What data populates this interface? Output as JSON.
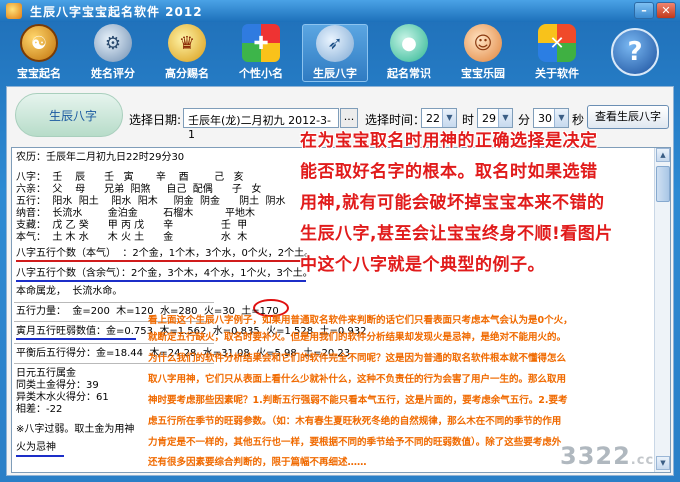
{
  "window": {
    "title": "生辰八字宝宝起名软件 2012"
  },
  "toolbar": [
    {
      "label": "宝宝起名",
      "icon": "yin-yang-icon"
    },
    {
      "label": "姓名评分",
      "icon": "gear-icon"
    },
    {
      "label": "高分赐名",
      "icon": "crowns-icon"
    },
    {
      "label": "个性小名",
      "icon": "puzzle-icon"
    },
    {
      "label": "生辰八字",
      "icon": "bird-icon"
    },
    {
      "label": "起名常识",
      "icon": "water-drop-icon"
    },
    {
      "label": "宝宝乐园",
      "icon": "baby-icon"
    },
    {
      "label": "关于软件",
      "icon": "butterfly-icon"
    },
    {
      "label": "",
      "icon": "help-icon"
    }
  ],
  "panel": {
    "section_label": "生辰八字",
    "date_label": "选择日期:",
    "date_value": "壬辰年(龙)二月初九 2012-3-1",
    "dots": "...",
    "time_label": "选择时间：",
    "hour": "22",
    "hour_unit": "时",
    "minute": "29",
    "minute_unit": "分",
    "second": "30",
    "second_unit": "秒",
    "view_button": "查看生辰八字"
  },
  "output": {
    "lines": [
      "农历：壬辰年二月初九日22时29分30",
      "",
      "八字：  壬    辰      壬   寅       辛    酉        己   亥",
      "六亲：  父    母      兄弟  阳煞     自己  配偶      子   女",
      "五行：  阳水  阳土    阳水  阳木     阴金  阴金      阴土  阴水",
      "纳音：  长流水        金泊金        石榴木          平地木",
      "支藏：  戊 乙 癸      甲 丙 戊      辛               壬  甲",
      "本气：  土 木 水      木 火 土      金               水  木",
      "八字五行个数（本气）  ：2个金，1个木，3个水，0个火，2个土。",
      "八字五行个数（含余气）：2个金，3个木，4个水，1个火，3个土。",
      "本命属龙，  长流水命。",
      "五行力量：  金=200  木=120  水=280  火=30  土=170",
      "寅月五行旺弱数值：金=0.753  木=1.562  水=0.835  火=1.528  土=0.932",
      "平衡后五行得分：金=18.44  木=24.28  水=31.08  火=5.98  土=20.23",
      "日元五行属金",
      "同类土金得分：39",
      "异类木水火得分：61",
      "相差：-22",
      "※八字过弱。取土金为用神",
      "火为忌神"
    ]
  },
  "overlay": {
    "headline": [
      "在为宝宝取名时用神的正确选择是决定",
      "能否取好名字的根本。取名时如果选错",
      "用神,就有可能会破坏掉宝宝本来不错的",
      "生辰八字,甚至会让宝宝终身不顺!看图片",
      "中这个八字就是个典型的例子。"
    ],
    "body": [
      "看上面这个生辰八字例子，如果用普通取名软件来判断的话它们只看表面只考虑本气会认为是0个火，",
      "就断定五行缺火，取名时要补火。但是用我们的软件分析结果却发现火是忌神，是绝对不能用火的。",
      "为什么我们的软件分析结果会和它们的软件完全不同呢？这是因为普通的取名软件根本就不懂得怎么",
      "取八字用神，它们只从表面上看什么少就补什么，这种不负责任的行为会害了用户一生的。那么取用",
      "神时要考虑那些因素呢？1.判断五行强弱不能只看本气五行，这是片面的，要考虑余气五行。2.要考",
      "虑五行所在季节的旺弱参数。（如：木有春生夏旺秋死冬绝的自然规律，那么木在不同的季节的作用",
      "力肯定是不一样的，其他五行也一样，要根据不同的季节给予不同的旺弱数值）。除了这些要考虑外",
      "还有很多因素要综合判断的，限于篇幅不再细述……"
    ]
  },
  "watermark": {
    "main": "3322",
    "suffix": ".cc"
  }
}
